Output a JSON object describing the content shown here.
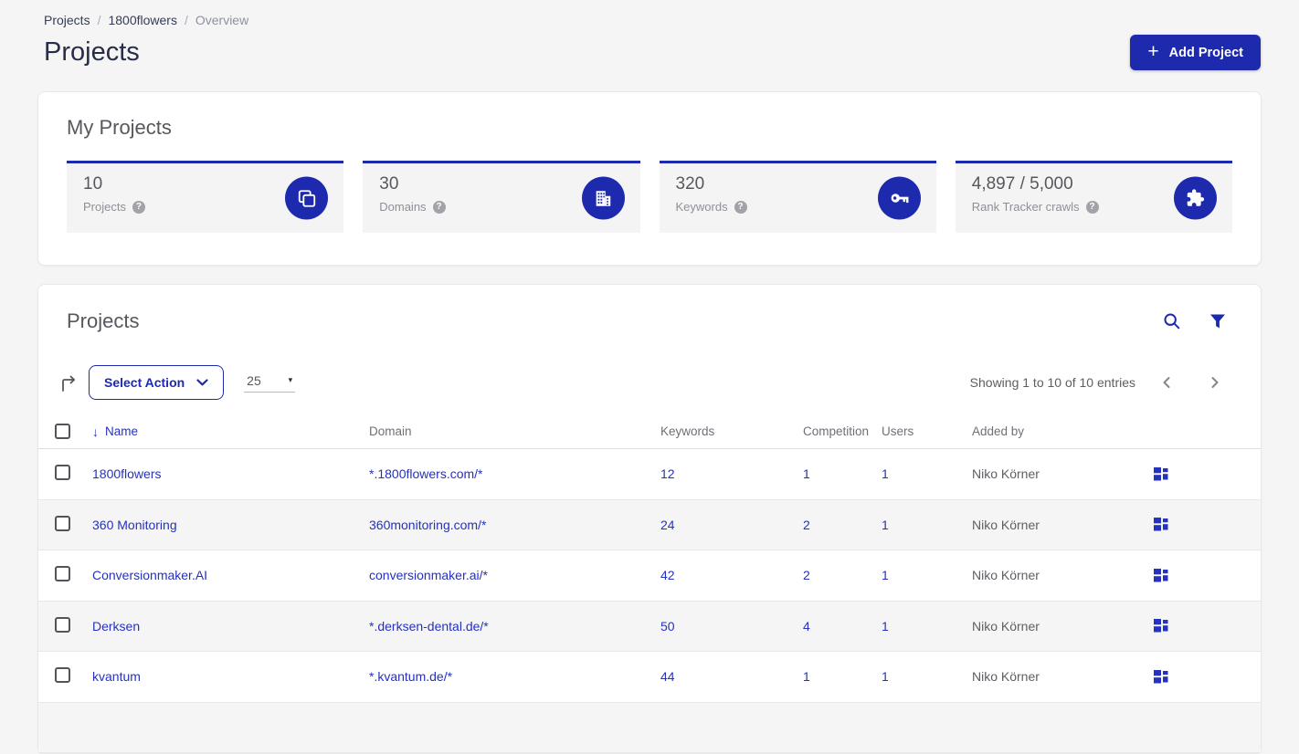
{
  "colors": {
    "brand_blue": "#1e2aad",
    "link_blue": "#2531c0",
    "page_bg": "#f5f5f6",
    "stat_bg": "#f4f4f5"
  },
  "breadcrumb": {
    "separator": "/",
    "items": [
      "Projects",
      "1800flowers",
      "Overview"
    ]
  },
  "page": {
    "title": "Projects"
  },
  "header": {
    "add_project_label": "Add Project",
    "plus_glyph": "+"
  },
  "help_glyph": "?",
  "my_projects": {
    "title": "My Projects",
    "stats": [
      {
        "value": "10",
        "label": "Projects",
        "icon": "projects-copy-icon"
      },
      {
        "value": "30",
        "label": "Domains",
        "icon": "building-icon"
      },
      {
        "value": "320",
        "label": "Keywords",
        "icon": "key-icon"
      },
      {
        "value": "4,897 / 5,000",
        "label": "Rank Tracker crawls",
        "icon": "puzzle-icon"
      }
    ]
  },
  "projects_table": {
    "title": "Projects",
    "select_action_label": "Select Action",
    "page_size": "25",
    "caret_glyph": "▾",
    "showing_text": "Showing 1 to 10 of 10 entries",
    "sort_glyph": "↓",
    "columns": {
      "name": "Name",
      "domain": "Domain",
      "keywords": "Keywords",
      "competition": "Competition",
      "users": "Users",
      "added_by": "Added by"
    },
    "rows": [
      {
        "name": "1800flowers",
        "domain": "*.1800flowers.com/*",
        "keywords": "12",
        "competition": "1",
        "users": "1",
        "added_by": "Niko Körner"
      },
      {
        "name": "360 Monitoring",
        "domain": "360monitoring.com/*",
        "keywords": "24",
        "competition": "2",
        "users": "1",
        "added_by": "Niko Körner"
      },
      {
        "name": "Conversionmaker.AI",
        "domain": "conversionmaker.ai/*",
        "keywords": "42",
        "competition": "2",
        "users": "1",
        "added_by": "Niko Körner"
      },
      {
        "name": "Derksen",
        "domain": "*.derksen-dental.de/*",
        "keywords": "50",
        "competition": "4",
        "users": "1",
        "added_by": "Niko Körner"
      },
      {
        "name": "kvantum",
        "domain": "*.kvantum.de/*",
        "keywords": "44",
        "competition": "1",
        "users": "1",
        "added_by": "Niko Körner"
      }
    ]
  }
}
